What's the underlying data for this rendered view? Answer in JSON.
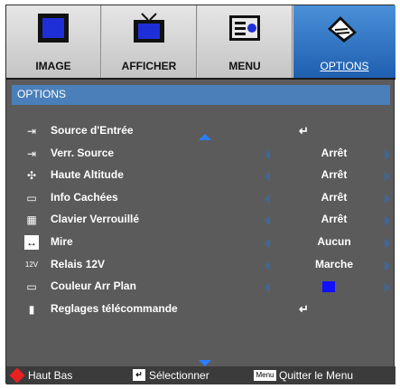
{
  "tabs": [
    {
      "label": "IMAGE",
      "icon": "image-icon"
    },
    {
      "label": "AFFICHER",
      "icon": "tv-display-icon"
    },
    {
      "label": "MENU",
      "icon": "menu-remote-icon"
    },
    {
      "label": "OPTIONS",
      "icon": "options-wrench-icon",
      "selected": true
    }
  ],
  "header": {
    "title": "OPTIONS"
  },
  "rows": [
    {
      "label": "Source d'Entrée",
      "value": "↵",
      "icon": "input-source-icon",
      "type": "enter"
    },
    {
      "label": "Verr. Source",
      "value": "Arrêt",
      "icon": "source-lock-icon",
      "type": "select"
    },
    {
      "label": "Haute Altitude",
      "value": "Arrêt",
      "icon": "fan-altitude-icon",
      "type": "select"
    },
    {
      "label": "Info Cachées",
      "value": "Arrêt",
      "icon": "hidden-info-icon",
      "type": "select"
    },
    {
      "label": "Clavier Verrouillé",
      "value": "Arrêt",
      "icon": "keypad-lock-icon",
      "type": "select"
    },
    {
      "label": "Mire",
      "value": "Aucun",
      "icon": "test-pattern-icon",
      "type": "select"
    },
    {
      "label": "Relais 12V",
      "value": "Marche",
      "icon": "relay-12v-icon",
      "type": "select"
    },
    {
      "label": "Couleur Arr Plan",
      "value": "",
      "icon": "background-color-icon",
      "type": "color",
      "color": "#1010ff"
    },
    {
      "label": "Reglages télécommande",
      "value": "↵",
      "icon": "remote-settings-icon",
      "type": "enter"
    }
  ],
  "footer": {
    "nav_label": "Haut Bas",
    "select_label": "Sélectionner",
    "menu_key": "Menu",
    "exit_label": "Quitter le Menu"
  },
  "colors": {
    "accent": "#4a7fb9",
    "selected_tab": "#1f5fb0",
    "arrow": "#2a7fff"
  }
}
